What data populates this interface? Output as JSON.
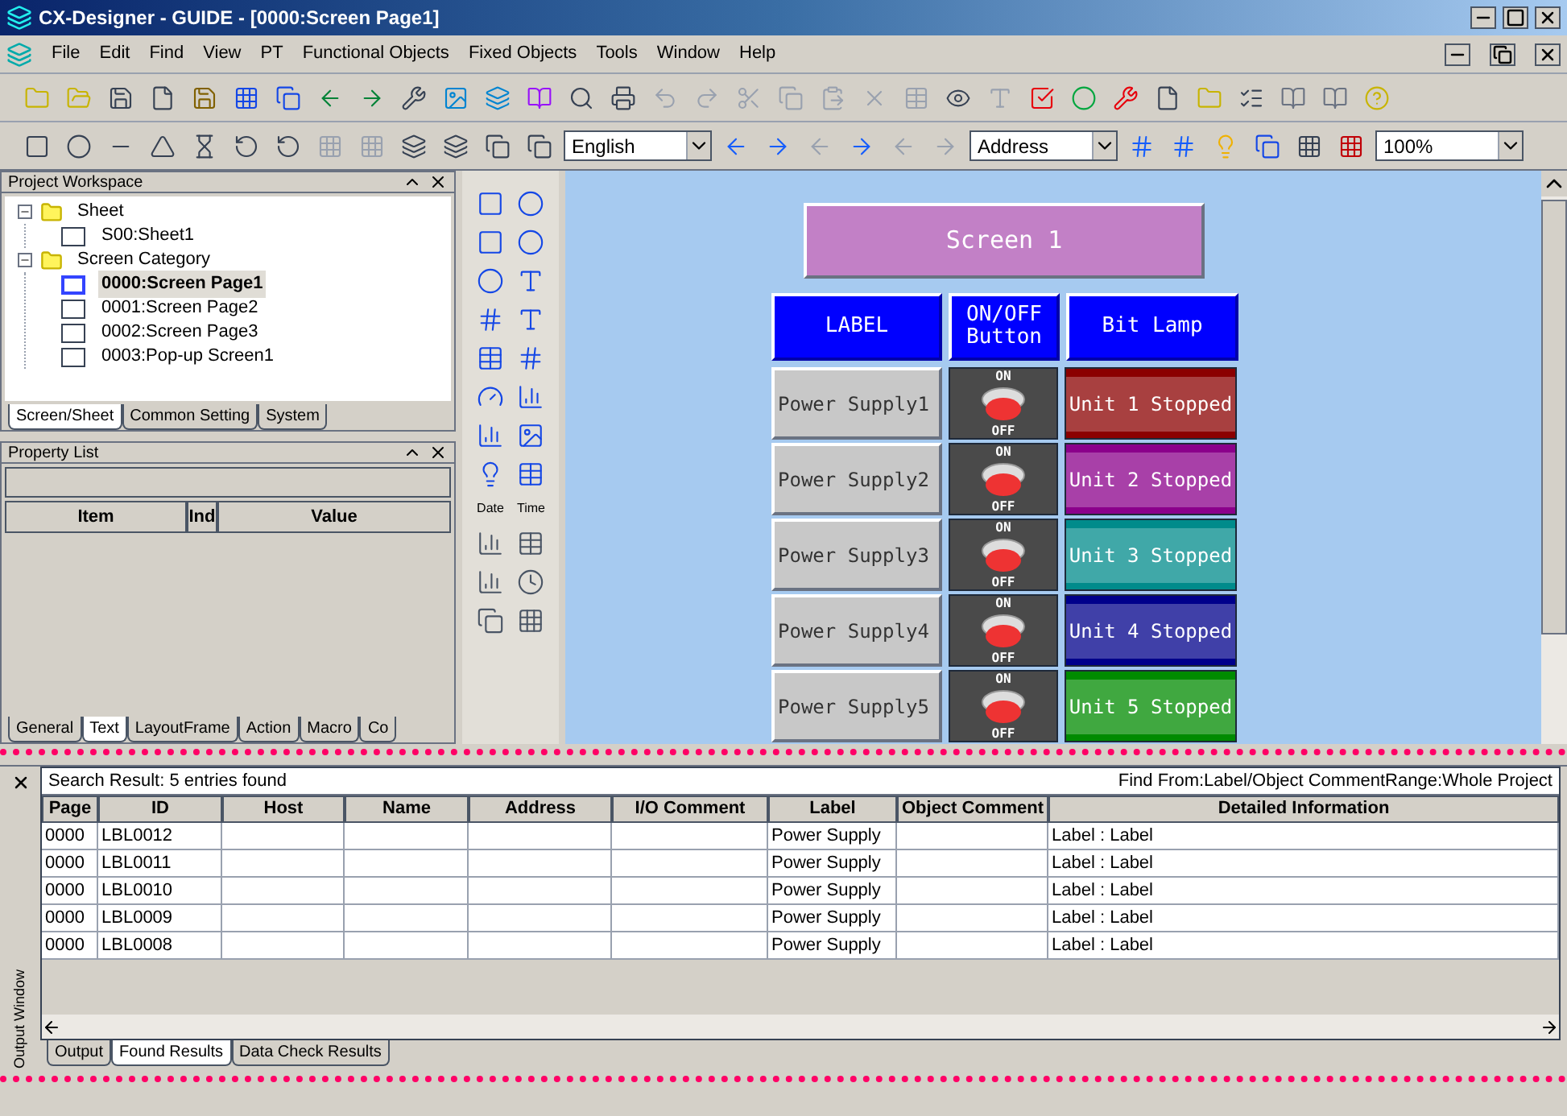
{
  "window": {
    "title": "CX-Designer - GUIDE - [0000:Screen Page1]"
  },
  "menu": [
    "File",
    "Edit",
    "Find",
    "View",
    "PT",
    "Functional Objects",
    "Fixed Objects",
    "Tools",
    "Window",
    "Help"
  ],
  "toolbar": {
    "language": "English",
    "display": "Address",
    "zoom": "100%"
  },
  "workspace": {
    "title": "Project Workspace",
    "tree": [
      {
        "label": "Sheet",
        "expanded": true,
        "children": [
          {
            "label": "S00:Sheet1",
            "selected": false
          }
        ]
      },
      {
        "label": "Screen Category",
        "expanded": true,
        "children": [
          {
            "label": "0000:Screen Page1",
            "selected": true
          },
          {
            "label": "0001:Screen Page2",
            "selected": false
          },
          {
            "label": "0002:Screen Page3",
            "selected": false
          },
          {
            "label": "0003:Pop-up Screen1",
            "selected": false
          }
        ]
      }
    ],
    "tabs": [
      {
        "label": "Screen/Sheet",
        "selected": true
      },
      {
        "label": "Common Setting",
        "selected": false
      },
      {
        "label": "System",
        "selected": false
      }
    ]
  },
  "property_list": {
    "title": "Property List",
    "columns": [
      "Item",
      "Ind",
      "Value"
    ],
    "tabs": [
      {
        "label": "General",
        "selected": false
      },
      {
        "label": "Text",
        "selected": true
      },
      {
        "label": "LayoutFrame",
        "selected": false
      },
      {
        "label": "Action",
        "selected": false
      },
      {
        "label": "Macro",
        "selected": false
      },
      {
        "label": "Co",
        "selected": false
      }
    ]
  },
  "palette": {
    "date": "Date",
    "time": "Time"
  },
  "canvas": {
    "screen_title": "Screen 1",
    "headers": [
      "LABEL",
      "ON/OFF Button",
      "Bit Lamp"
    ],
    "rows": [
      {
        "label": "Power Supply1",
        "on": "ON",
        "off": "OFF",
        "switched_on": false,
        "lamp": "Unit 1 Stopped",
        "color": "#8b0000"
      },
      {
        "label": "Power Supply2",
        "on": "ON",
        "off": "OFF",
        "switched_on": false,
        "lamp": "Unit 2 Stopped",
        "color": "#8b008b"
      },
      {
        "label": "Power Supply3",
        "on": "ON",
        "off": "OFF",
        "switched_on": false,
        "lamp": "Unit 3 Stopped",
        "color": "#008b8b"
      },
      {
        "label": "Power Supply4",
        "on": "ON",
        "off": "OFF",
        "switched_on": false,
        "lamp": "Unit 4 Stopped",
        "color": "#00008b"
      },
      {
        "label": "Power Supply5",
        "on": "ON",
        "off": "OFF",
        "switched_on": false,
        "lamp": "Unit 5 Stopped",
        "color": "#008b00"
      }
    ]
  },
  "output": {
    "side_label": "Output Window",
    "summary": "Search Result: 5 entries found",
    "scope": "Find From:Label/Object CommentRange:Whole Project",
    "columns": [
      "Page",
      "ID",
      "Host",
      "Name",
      "Address",
      "I/O Comment",
      "Label",
      "Object Comment",
      "Detailed Information"
    ],
    "rows": [
      [
        "0000",
        "LBL0012",
        "",
        "",
        "",
        "",
        "Power Supply",
        "",
        "Label : Label"
      ],
      [
        "0000",
        "LBL0011",
        "",
        "",
        "",
        "",
        "Power Supply",
        "",
        "Label : Label"
      ],
      [
        "0000",
        "LBL0010",
        "",
        "",
        "",
        "",
        "Power Supply",
        "",
        "Label : Label"
      ],
      [
        "0000",
        "LBL0009",
        "",
        "",
        "",
        "",
        "Power Supply",
        "",
        "Label : Label"
      ],
      [
        "0000",
        "LBL0008",
        "",
        "",
        "",
        "",
        "Power Supply",
        "",
        "Label : Label"
      ]
    ],
    "tabs": [
      {
        "label": "Output",
        "selected": false
      },
      {
        "label": "Found Results",
        "selected": true
      },
      {
        "label": "Data Check Results",
        "selected": false
      }
    ]
  }
}
